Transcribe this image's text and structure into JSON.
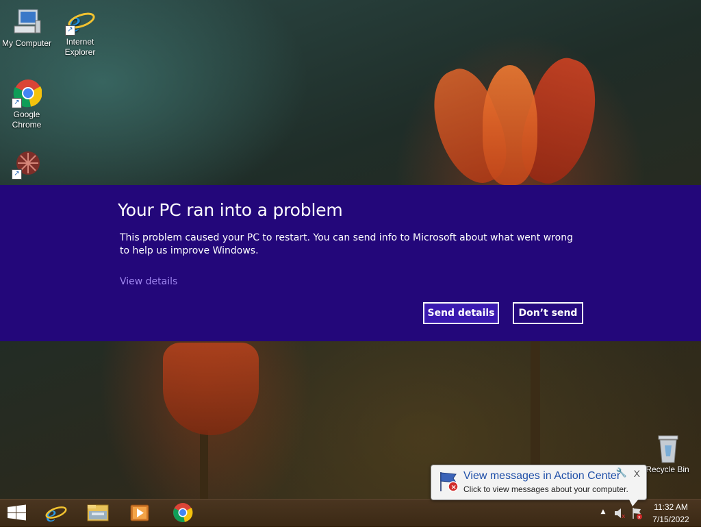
{
  "desktop": {
    "icons": [
      {
        "label": "My Computer",
        "icon": "computer-icon"
      },
      {
        "label": "Internet Explorer",
        "icon": "internet-explorer-icon"
      },
      {
        "label": "Google Chrome",
        "icon": "chrome-icon"
      },
      {
        "label": "Recycle Bin",
        "icon": "recycle-bin-icon"
      }
    ]
  },
  "error_dialog": {
    "title": "Your PC ran into a problem",
    "message": "This problem caused your PC to restart. You can send info to Microsoft about what went wrong to help us improve Windows.",
    "view_details": "View details",
    "send_button": "Send details",
    "dont_send_button": "Don’t send",
    "background_color": "#23077a",
    "link_color": "#9f86f0"
  },
  "notification": {
    "title": "View messages in Action Center",
    "text": "Click to view messages about your computer.",
    "close_label": "X",
    "icon": "action-center-flag-icon"
  },
  "taskbar": {
    "pinned": [
      "windows-start-icon",
      "internet-explorer-icon",
      "file-explorer-icon",
      "media-player-icon",
      "chrome-icon"
    ],
    "tray_icons": [
      "show-hidden-icons-arrow",
      "volume-muted-icon",
      "action-center-flag-icon"
    ],
    "time": "11:32 AM",
    "date": "7/15/2022"
  }
}
